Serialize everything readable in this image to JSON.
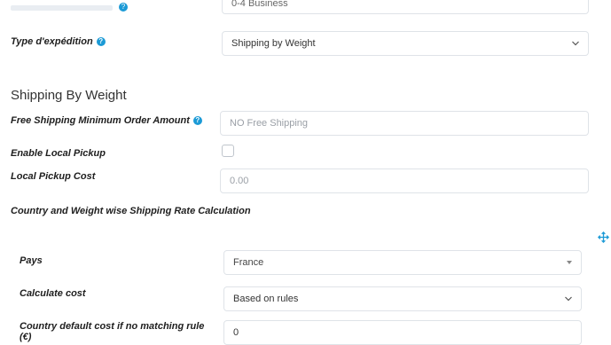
{
  "top_row": {
    "partial_value": "0-4 Business"
  },
  "shipping_type": {
    "label": "Type d'expédition",
    "value": "Shipping by Weight"
  },
  "section": {
    "title": "Shipping By Weight"
  },
  "free_shipping": {
    "label": "Free Shipping Minimum Order Amount",
    "placeholder": "NO Free Shipping"
  },
  "local_pickup": {
    "label": "Enable Local Pickup"
  },
  "pickup_cost": {
    "label": "Local Pickup Cost",
    "placeholder": "0.00"
  },
  "country_weight": {
    "label": "Country and Weight wise Shipping Rate Calculation"
  },
  "pays": {
    "label": "Pays",
    "value": "France"
  },
  "calc_cost": {
    "label": "Calculate cost",
    "value": "Based on rules"
  },
  "default_cost": {
    "label": "Country default cost if no matching rule",
    "label_suffix": "(€)",
    "value": "0"
  },
  "icons": {
    "help": "info-icon",
    "move": "move-icon",
    "chevron": "chevron-down-icon"
  }
}
